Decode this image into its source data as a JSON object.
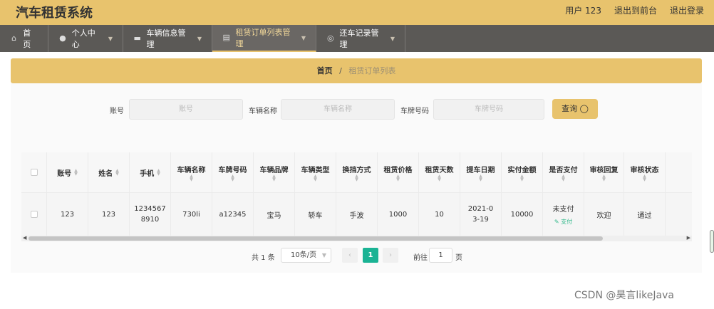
{
  "app": {
    "title": "汽车租赁系统",
    "user_label": "用户 123",
    "front_link": "退出到前台",
    "logout_link": "退出登录"
  },
  "nav": [
    {
      "label": "首页",
      "icon": "home-icon"
    },
    {
      "label": "个人中心",
      "icon": "user-icon"
    },
    {
      "label": "车辆信息管理",
      "icon": "car-icon"
    },
    {
      "label": "租赁订单列表管理",
      "icon": "order-icon"
    },
    {
      "label": "还车记录管理",
      "icon": "return-icon"
    }
  ],
  "breadcrumb": {
    "home": "首页",
    "separator": "/",
    "current": "租赁订单列表"
  },
  "search": {
    "account_label": "账号",
    "account_placeholder": "账号",
    "car_name_label": "车辆名称",
    "car_name_placeholder": "车辆名称",
    "plate_label": "车牌号码",
    "plate_placeholder": "车牌号码",
    "query_button": "查询"
  },
  "table": {
    "columns": [
      "账号",
      "姓名",
      "手机",
      "车辆名称",
      "车牌号码",
      "车辆品牌",
      "车辆类型",
      "换挡方式",
      "租赁价格",
      "租赁天数",
      "提车日期",
      "实付金额",
      "是否支付",
      "审核回复",
      "审核状态"
    ],
    "rows": [
      {
        "account": "123",
        "name": "123",
        "phone": "12345678910",
        "car_name": "730li",
        "plate": "a12345",
        "brand": "宝马",
        "type": "轿车",
        "gear": "手波",
        "price": "1000",
        "days": "10",
        "pickup_date": "2021-03-19",
        "paid_amount": "10000",
        "payment_status": "未支付",
        "pay_action": "支付",
        "review_reply": "欢迎",
        "review_status": "通过"
      }
    ]
  },
  "pagination": {
    "total": "共 1 条",
    "page_size": "10条/页",
    "current_page": "1",
    "goto_label": "前往",
    "goto_value": "1",
    "page_unit": "页"
  },
  "watermark": "CSDN @昊言likeJava",
  "colors": {
    "brand": "#e8c36d",
    "nav_bg": "#5b5956",
    "accent": "#1ab394"
  }
}
